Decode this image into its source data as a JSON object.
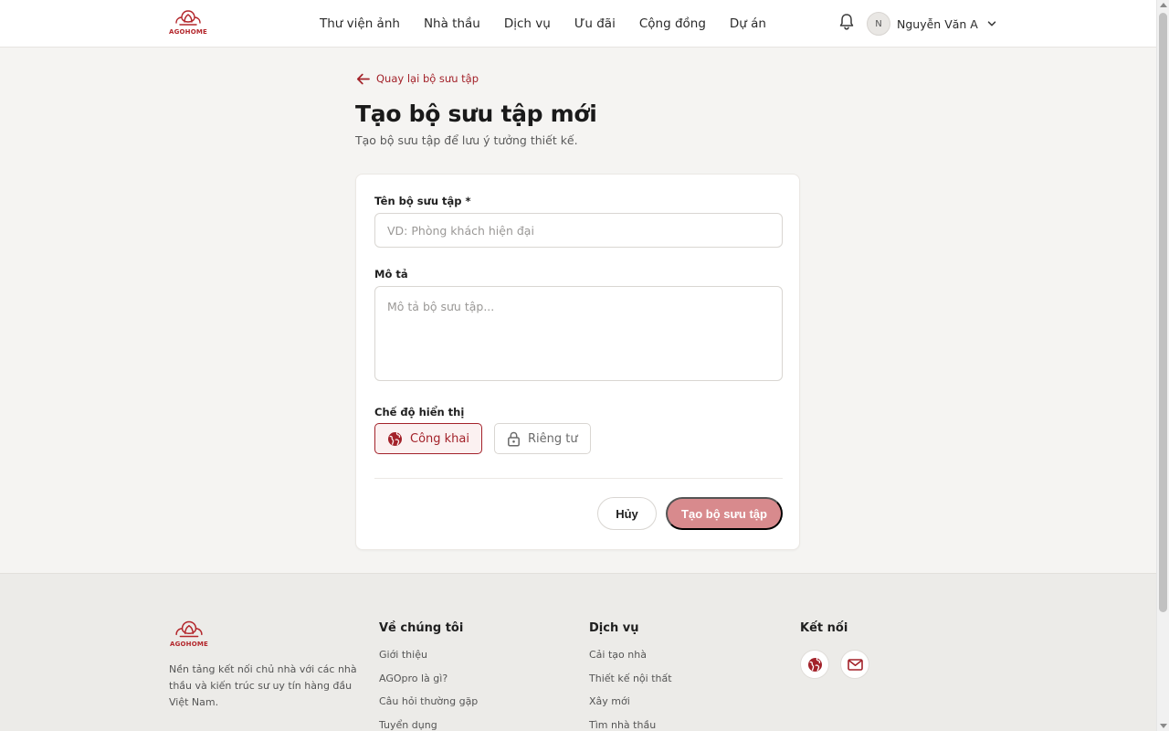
{
  "brand": {
    "logo_text": "AGOHOME",
    "color": "#b3262b"
  },
  "nav": {
    "items": [
      "Thư viện ảnh",
      "Nhà thầu",
      "Dịch vụ",
      "Ưu đãi",
      "Cộng đồng",
      "Dự án"
    ]
  },
  "header": {
    "user_initial": "N",
    "user_name": "Nguyễn Văn A"
  },
  "page": {
    "back_label": "Quay lại bộ sưu tập",
    "title": "Tạo bộ sưu tập mới",
    "subtitle": "Tạo bộ sưu tập để lưu ý tưởng thiết kế."
  },
  "form": {
    "name_label": "Tên bộ sưu tập *",
    "name_value": "",
    "name_placeholder": "VD: Phòng khách hiện đại",
    "desc_label": "Mô tả",
    "desc_value": "",
    "desc_placeholder": "Mô tả bộ sưu tập...",
    "visibility_label": "Chế độ hiển thị",
    "visibility_public": "Công khai",
    "visibility_private": "Riêng tư",
    "visibility_selected": "Công khai",
    "cancel_label": "Hủy",
    "submit_label": "Tạo bộ sưu tập"
  },
  "footer": {
    "logo_text": "AGOHOME",
    "description": "Nền tảng kết nối chủ nhà với các nhà thầu và kiến trúc sư uy tín hàng đầu Việt Nam.",
    "about": {
      "title": "Về chúng tôi",
      "links": [
        "Giới thiệu",
        "AGOpro là gì?",
        "Câu hỏi thường gặp",
        "Tuyển dụng"
      ]
    },
    "services": {
      "title": "Dịch vụ",
      "links": [
        "Cải tạo nhà",
        "Thiết kế nội thất",
        "Xây mới",
        "Tìm nhà thầu"
      ]
    },
    "connect": {
      "title": "Kết nối",
      "icons": [
        "globe-icon",
        "mail-icon"
      ]
    }
  },
  "colors": {
    "accent": "#a3222a",
    "accent_soft": "#d88a8d",
    "background": "#f5f4f2"
  }
}
